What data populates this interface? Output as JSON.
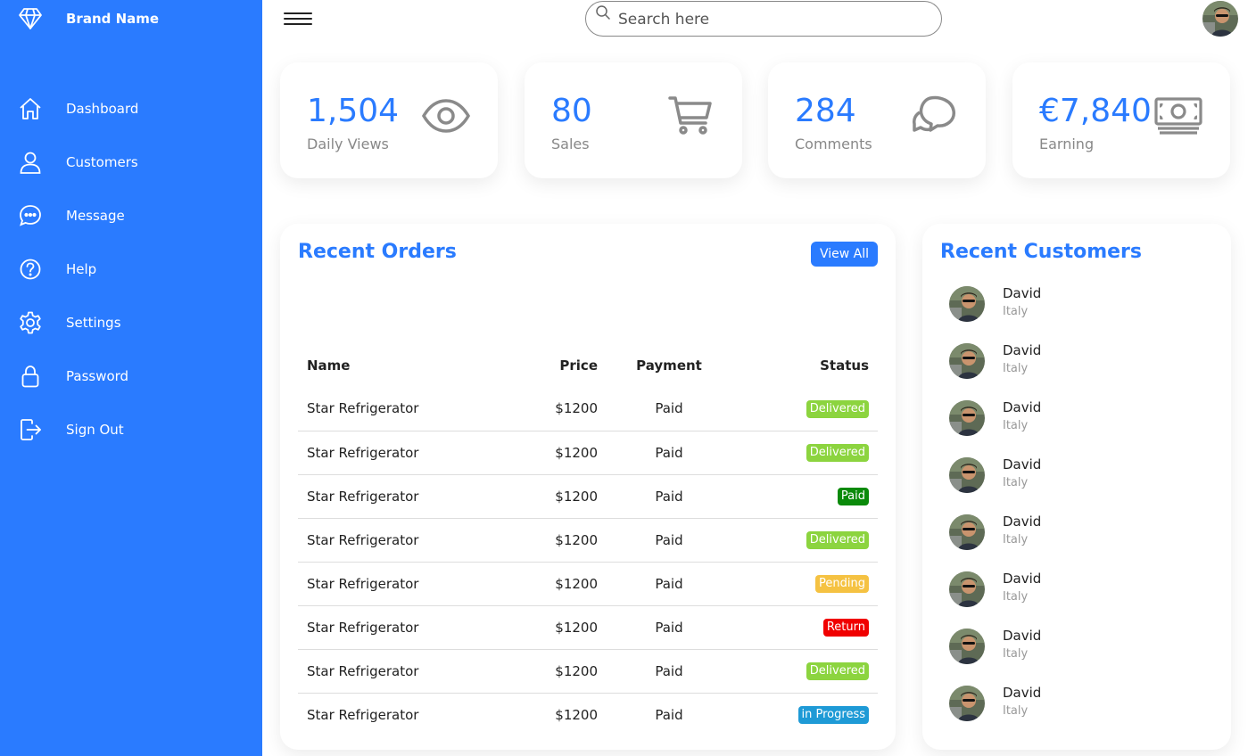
{
  "brand": {
    "name": "Brand Name",
    "icon": "diamond-icon"
  },
  "sidebar": {
    "items": [
      {
        "label": "Dashboard",
        "icon": "home-icon"
      },
      {
        "label": "Customers",
        "icon": "person-icon"
      },
      {
        "label": "Message",
        "icon": "chat-icon"
      },
      {
        "label": "Help",
        "icon": "help-icon"
      },
      {
        "label": "Settings",
        "icon": "gear-icon"
      },
      {
        "label": "Password",
        "icon": "lock-icon"
      },
      {
        "label": "Sign Out",
        "icon": "sign-out-icon"
      }
    ]
  },
  "search": {
    "placeholder": "Search here",
    "value": ""
  },
  "cards": [
    {
      "value": "1,504",
      "label": "Daily Views",
      "icon": "eye-icon"
    },
    {
      "value": "80",
      "label": "Sales",
      "icon": "cart-icon"
    },
    {
      "value": "284",
      "label": "Comments",
      "icon": "comments-icon"
    },
    {
      "value": "€7,840",
      "label": "Earning",
      "icon": "money-icon"
    }
  ],
  "orders": {
    "title": "Recent Orders",
    "view_all_label": "View All",
    "columns": [
      "Name",
      "Price",
      "Payment",
      "Status"
    ],
    "rows": [
      {
        "name": "Star Refrigerator",
        "price": "$1200",
        "payment": "Paid",
        "status": "Delivered",
        "status_color": "#8cd43f"
      },
      {
        "name": "Star Refrigerator",
        "price": "$1200",
        "payment": "Paid",
        "status": "Delivered",
        "status_color": "#8cd43f"
      },
      {
        "name": "Star Refrigerator",
        "price": "$1200",
        "payment": "Paid",
        "status": "Paid",
        "status_color": "#0a8a0a"
      },
      {
        "name": "Star Refrigerator",
        "price": "$1200",
        "payment": "Paid",
        "status": "Delivered",
        "status_color": "#8cd43f"
      },
      {
        "name": "Star Refrigerator",
        "price": "$1200",
        "payment": "Paid",
        "status": "Pending",
        "status_color": "#f5c242"
      },
      {
        "name": "Star Refrigerator",
        "price": "$1200",
        "payment": "Paid",
        "status": "Return",
        "status_color": "#f00000"
      },
      {
        "name": "Star Refrigerator",
        "price": "$1200",
        "payment": "Paid",
        "status": "Delivered",
        "status_color": "#8cd43f"
      },
      {
        "name": "Star Refrigerator",
        "price": "$1200",
        "payment": "Paid",
        "status": "in Progress",
        "status_color": "#1e9ad6"
      }
    ]
  },
  "customers": {
    "title": "Recent Customers",
    "items": [
      {
        "name": "David",
        "country": "Italy"
      },
      {
        "name": "David",
        "country": "Italy"
      },
      {
        "name": "David",
        "country": "Italy"
      },
      {
        "name": "David",
        "country": "Italy"
      },
      {
        "name": "David",
        "country": "Italy"
      },
      {
        "name": "David",
        "country": "Italy"
      },
      {
        "name": "David",
        "country": "Italy"
      },
      {
        "name": "David",
        "country": "Italy"
      }
    ]
  },
  "colors": {
    "accent": "#2a7bff",
    "icon_gray": "#8a8a8a"
  }
}
